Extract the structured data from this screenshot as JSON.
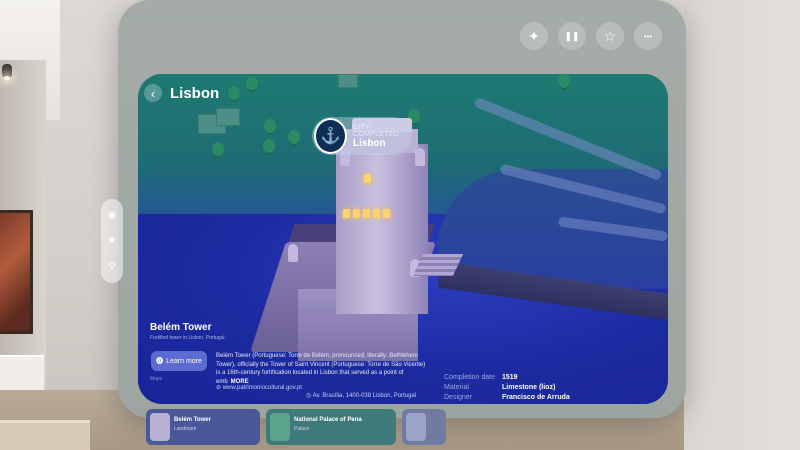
{
  "top_controls": {
    "sparkle_icon": "sparkle-icon",
    "pause_icon": "pause-icon",
    "star_icon": "star-icon",
    "more_icon": "more-icon",
    "pause_glyph": "❚❚",
    "star_glyph": "☆",
    "more_glyph": "•••",
    "sparkle_glyph": "✦"
  },
  "map": {
    "title": "Lisbon",
    "back_glyph": "‹"
  },
  "badge": {
    "line1": "CITY COMPLETED",
    "line2": "Lisbon",
    "icon_glyph": "⚓"
  },
  "side_toolbar": {
    "items": [
      {
        "name": "compass-icon",
        "glyph": "◉"
      },
      {
        "name": "star-icon",
        "glyph": "★"
      },
      {
        "name": "gift-icon",
        "glyph": "⚲"
      }
    ]
  },
  "info": {
    "name": "Belém Tower",
    "subtitle": "Fortified tower in Lisbon, Portugal",
    "learn_more": "Learn more",
    "maps_credit": " Maps",
    "description": "Belém Tower (Portuguese: Torre de Belém, pronounced; literally: Bethlehem Tower), officially the Tower of Saint Vincent (Portuguese: Torre de São Vicente) is a 16th-century fortification located in Lisbon that served as a point of emb",
    "more": "MORE",
    "website": "www.patrimoniocultural.gov.pt",
    "address": "Av. Brasília, 1400-038 Lisbon, Portugal"
  },
  "facts": [
    {
      "label": "Completion date",
      "value": "1519"
    },
    {
      "label": "Material",
      "value": "Limestone (lioz)"
    },
    {
      "label": "Designer",
      "value": "Francisco de Arruda"
    }
  ],
  "carousel": [
    {
      "name": "Belém Tower",
      "type": "Landmark"
    },
    {
      "name": "National Palace of Pena",
      "type": "Palace"
    },
    {
      "name": "",
      "type": ""
    }
  ]
}
